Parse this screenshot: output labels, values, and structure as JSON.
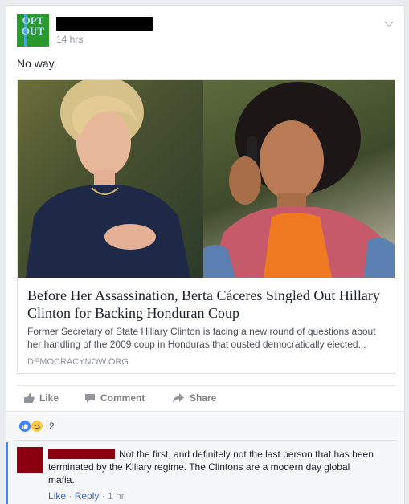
{
  "post": {
    "avatar_text": "OPT\nOUT",
    "time": "14 hrs",
    "text": "No way."
  },
  "link": {
    "title": "Before Her Assassination, Berta Cáceres Singled Out Hillary Clinton for Backing Honduran Coup",
    "description": "Former Secretary of State Hillary Clinton is facing a new round of questions about her handling of the 2009 coup in Honduras that ousted democratically elected...",
    "domain": "DEMOCRACYNOW.ORG"
  },
  "actions": {
    "like": "Like",
    "comment": "Comment",
    "share": "Share"
  },
  "reactions": {
    "count": "2"
  },
  "comment": {
    "text": "Not the first, and definitely not the last person that has been terminated by the Killary regime. The Clintons are a modern day global mafia.",
    "like": "Like",
    "sep": "·",
    "reply": "Reply",
    "time": "1 hr"
  },
  "colors": {
    "link_blue": "#4267b2",
    "redaction": "#8a0011"
  }
}
